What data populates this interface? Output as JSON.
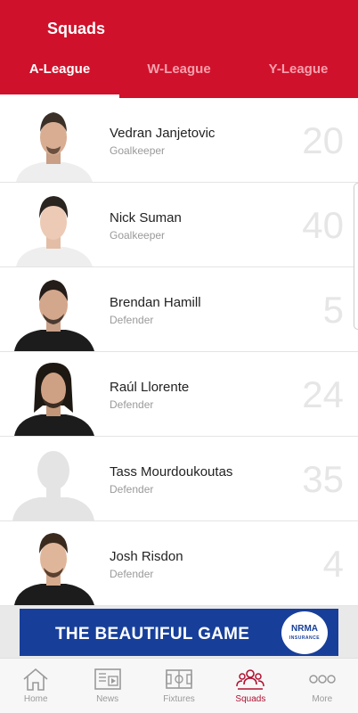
{
  "header": {
    "title": "Squads"
  },
  "tabs": [
    {
      "label": "A-League",
      "active": true
    },
    {
      "label": "W-League",
      "active": false
    },
    {
      "label": "Y-League",
      "active": false
    }
  ],
  "players": [
    {
      "name": "Vedran Janjetovic",
      "position": "Goalkeeper",
      "number": "20"
    },
    {
      "name": "Nick Suman",
      "position": "Goalkeeper",
      "number": "40"
    },
    {
      "name": "Brendan Hamill",
      "position": "Defender",
      "number": "5"
    },
    {
      "name": "Raúl Llorente",
      "position": "Defender",
      "number": "24"
    },
    {
      "name": "Tass Mourdoukoutas",
      "position": "Defender",
      "number": "35"
    },
    {
      "name": "Josh Risdon",
      "position": "Defender",
      "number": "4"
    }
  ],
  "ad": {
    "text": "THE BEAUTIFUL GAME",
    "logo_top": "NRMA",
    "logo_bottom": "INSURANCE"
  },
  "nav": [
    {
      "label": "Home",
      "icon": "home-icon"
    },
    {
      "label": "News",
      "icon": "news-icon"
    },
    {
      "label": "Fixtures",
      "icon": "pitch-icon"
    },
    {
      "label": "Squads",
      "icon": "squads-icon",
      "active": true
    },
    {
      "label": "More",
      "icon": "more-icon"
    }
  ],
  "colors": {
    "brand_red": "#d0112b",
    "ad_blue": "#173f9a",
    "nav_active": "#b01030"
  }
}
